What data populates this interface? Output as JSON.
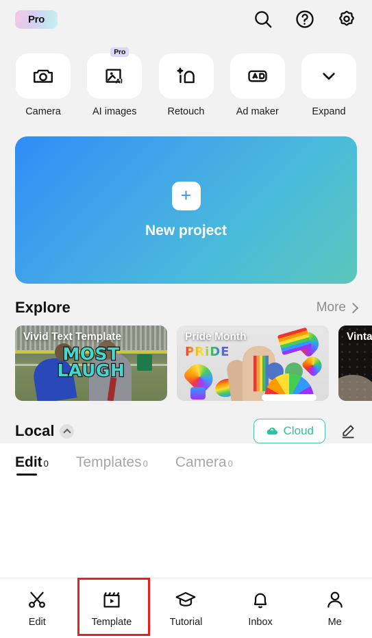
{
  "header": {
    "pro_badge": "Pro",
    "icons": [
      {
        "name": "search-icon",
        "label": "Search"
      },
      {
        "name": "help-icon",
        "label": "Help"
      },
      {
        "name": "settings-icon",
        "label": "Settings"
      }
    ]
  },
  "tools": [
    {
      "label": "Camera",
      "icon": "camera-icon",
      "badge": null
    },
    {
      "label": "AI images",
      "icon": "ai-image-icon",
      "badge": "Pro"
    },
    {
      "label": "Retouch",
      "icon": "retouch-icon",
      "badge": null
    },
    {
      "label": "Ad maker",
      "icon": "ad-maker-icon",
      "badge": null
    },
    {
      "label": "Expand",
      "icon": "chevron-down-icon",
      "badge": null
    }
  ],
  "new_project": {
    "label": "New project",
    "plus": "+",
    "gradient_from": "#2f8cf5",
    "gradient_to": "#5cc6bb"
  },
  "explore": {
    "title": "Explore",
    "more_label": "More",
    "cards": [
      {
        "title": "Vivid Text Template",
        "overlay_line1": "MOST",
        "overlay_line2": "LAUGH"
      },
      {
        "title": "Pride Month",
        "sticker_word": "PRiDE"
      },
      {
        "title": "Vinta"
      }
    ]
  },
  "local": {
    "title": "Local",
    "cloud_label": "Cloud",
    "cloud_color": "#2cbfa0",
    "tabs": [
      {
        "label": "Edit",
        "count": "0",
        "active": true
      },
      {
        "label": "Templates",
        "count": "0",
        "active": false
      },
      {
        "label": "Camera",
        "count": "0",
        "active": false
      }
    ]
  },
  "bottom_nav": {
    "items": [
      {
        "label": "Edit",
        "icon": "scissors-icon"
      },
      {
        "label": "Template",
        "icon": "clapperboard-icon"
      },
      {
        "label": "Tutorial",
        "icon": "graduation-cap-icon"
      },
      {
        "label": "Inbox",
        "icon": "bell-icon"
      },
      {
        "label": "Me",
        "icon": "person-icon"
      }
    ],
    "highlight": {
      "target": "Template",
      "color": "#ee1c1c"
    }
  }
}
